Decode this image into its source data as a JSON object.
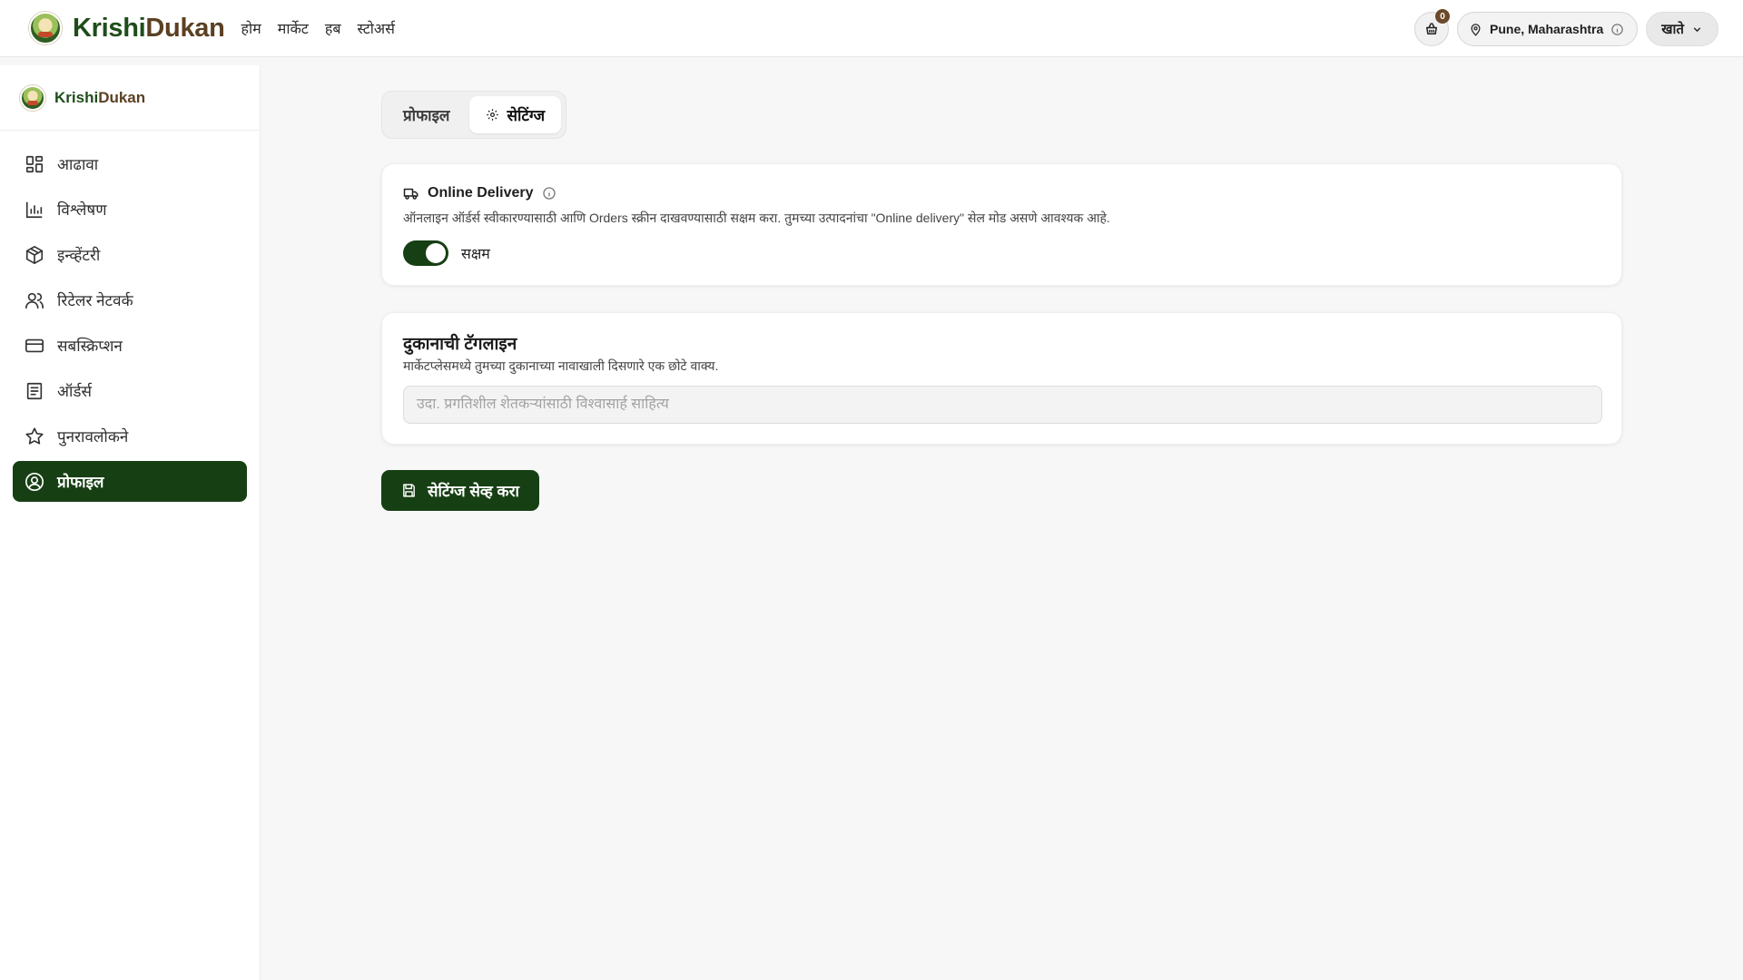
{
  "header": {
    "brand_part1": "Krishi",
    "brand_part2": "Dukan",
    "nav": [
      "होम",
      "मार्केट",
      "हब",
      "स्टोअर्स"
    ],
    "cart_count": "0",
    "location": "Pune, Maharashtra",
    "account_label": "खाते"
  },
  "sidebar": {
    "brand_part1": "Krishi",
    "brand_part2": "Dukan",
    "items": [
      {
        "label": "आढावा",
        "icon": "grid-icon"
      },
      {
        "label": "विश्लेषण",
        "icon": "bar-chart-icon"
      },
      {
        "label": "इन्व्हेंटरी",
        "icon": "box-icon"
      },
      {
        "label": "रिटेलर नेटवर्क",
        "icon": "users-icon"
      },
      {
        "label": "सबस्क्रिप्शन",
        "icon": "credit-card-icon"
      },
      {
        "label": "ऑर्डर्स",
        "icon": "document-icon"
      },
      {
        "label": "पुनरावलोकने",
        "icon": "star-icon"
      },
      {
        "label": "प्रोफाइल",
        "icon": "user-circle-icon",
        "active": true
      }
    ]
  },
  "tabs": {
    "profile": "प्रोफाइल",
    "settings": "सेटिंग्ज"
  },
  "delivery": {
    "title": "Online Delivery",
    "description": "ऑनलाइन ऑर्डर्स स्वीकारण्यासाठी आणि Orders स्क्रीन दाखवण्यासाठी सक्षम करा. तुमच्या उत्पादनांचा \"Online delivery\" सेल मोड असणे आवश्यक आहे.",
    "toggle_label": "सक्षम",
    "enabled": true
  },
  "tagline": {
    "title": "दुकानाची टॅगलाइन",
    "description": "मार्केटप्लेसमध्ये तुमच्या दुकानाच्या नावाखाली दिसणारे एक छोटे वाक्य.",
    "value": "",
    "placeholder": "उदा. प्रगतिशील शेतकऱ्यांसाठी विश्वासार्ह साहित्य"
  },
  "save_button": "सेटिंग्ज सेव्ह करा",
  "colors": {
    "primary": "#173f14",
    "brand_brown": "#5b4023"
  }
}
